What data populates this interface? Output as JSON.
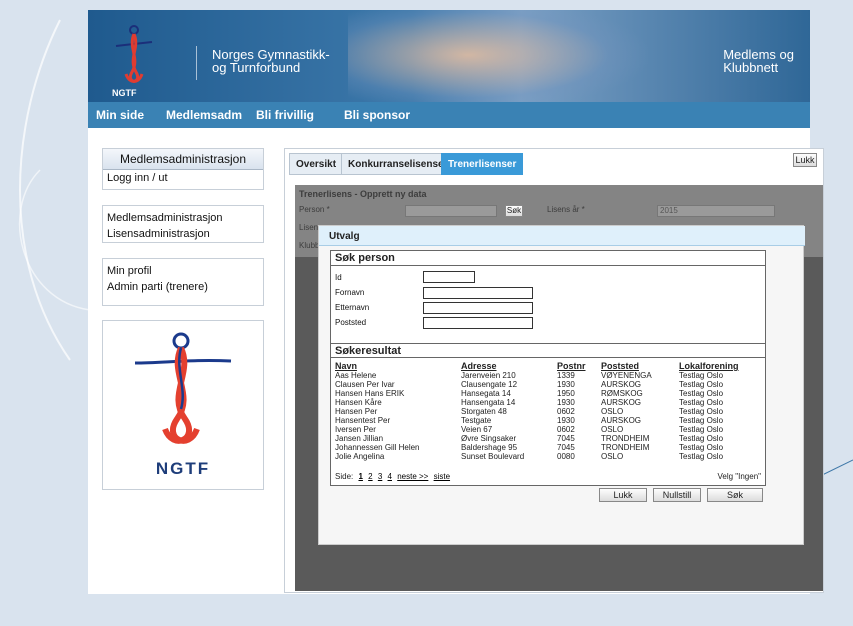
{
  "header": {
    "logo_text": "NGTF",
    "org_line1": "Norges Gymnastikk-",
    "org_line2": "og Turnforbund",
    "right_line1": "Medlems og",
    "right_line2": "Klubbnett"
  },
  "nav": [
    "Min side",
    "Medlemsadm",
    "Bli frivillig",
    "Bli sponsor"
  ],
  "sidebar": {
    "box1_title": "Medlemsadministrasjon",
    "box1_items": [
      "Logg inn / ut"
    ],
    "box2_items": [
      "Medlemsadministrasjon",
      "Lisensadministrasjon"
    ],
    "box3_items": [
      "Min profil",
      "Admin parti (trenere)"
    ],
    "logo_text": "NGTF"
  },
  "tabs": [
    "Oversikt",
    "Konkurranselisenser",
    "Trenerlisenser"
  ],
  "active_tab": "Trenerlisenser",
  "lukk_top": "Lukk",
  "form": {
    "title": "Trenerlisens - Opprett ny data",
    "person_label": "Person *",
    "sok_button": "Søk",
    "lisens_ar_label": "Lisens år *",
    "lisens_ar_value": "2015",
    "lisens_label": "Lisen",
    "klubb_label": "Klubb"
  },
  "dialog": {
    "title": "Utvalg",
    "search_title": "Søk person",
    "fields": [
      "Id",
      "Fornavn",
      "Etternavn",
      "Poststed"
    ],
    "results_title": "Søkeresultat",
    "columns": [
      "Navn",
      "Adresse",
      "Postnr",
      "Poststed",
      "Lokalforening"
    ],
    "rows": [
      [
        "Aas Helene",
        "Jarenveien 210",
        "1339",
        "VØYENENGA",
        "Testlag Oslo"
      ],
      [
        "Clausen Per Ivar",
        "Clausengate 12",
        "1930",
        "AURSKOG",
        "Testlag Oslo"
      ],
      [
        "Hansen Hans ERIK",
        "Hansegata 14",
        "1950",
        "RØMSKOG",
        "Testlag Oslo"
      ],
      [
        "Hansen Kåre",
        "Hansengata 14",
        "1930",
        "AURSKOG",
        "Testlag Oslo"
      ],
      [
        "Hansen Per",
        "Storgaten 48",
        "0602",
        "OSLO",
        "Testlag Oslo"
      ],
      [
        "Hansentest Per",
        "Testgate",
        "1930",
        "AURSKOG",
        "Testlag Oslo"
      ],
      [
        "Iversen Per",
        "Veien 67",
        "0602",
        "OSLO",
        "Testlag Oslo"
      ],
      [
        "Jansen Jillian",
        "Øvre Singsaker",
        "7045",
        "TRONDHEIM",
        "Testlag Oslo"
      ],
      [
        "Johannessen Gill Helen",
        "Baldershage 95",
        "7045",
        "TRONDHEIM",
        "Testlag Oslo"
      ],
      [
        "Jolie Angelina",
        "Sunset Boulevard",
        "0080",
        "OSLO",
        "Testlag Oslo"
      ]
    ],
    "pager_label": "Side:",
    "pages": [
      "1",
      "2",
      "3",
      "4"
    ],
    "next": "neste >>",
    "last": "siste",
    "velg": "Velg \"Ingen\"",
    "buttons": [
      "Lukk",
      "Nullstill",
      "Søk"
    ]
  }
}
